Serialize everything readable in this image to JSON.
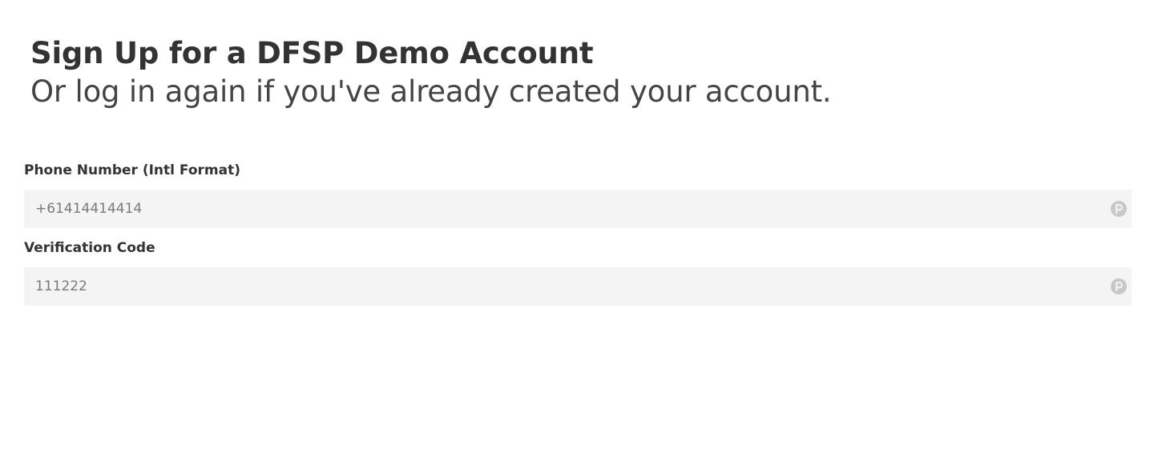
{
  "header": {
    "title": "Sign Up for a DFSP Demo Account",
    "subtitle": "Or log in again if you've already created your account."
  },
  "form": {
    "phone": {
      "label": "Phone Number (Intl Format)",
      "placeholder": "+61414414414",
      "value": ""
    },
    "code": {
      "label": "Verification Code",
      "placeholder": "111222",
      "value": ""
    }
  },
  "icons": {
    "field_autofill": "password-manager-icon"
  },
  "colors": {
    "text": "#333333",
    "input_background": "#f4f4f4",
    "placeholder": "#7a7a7a",
    "icon": "#c8c8c8"
  }
}
